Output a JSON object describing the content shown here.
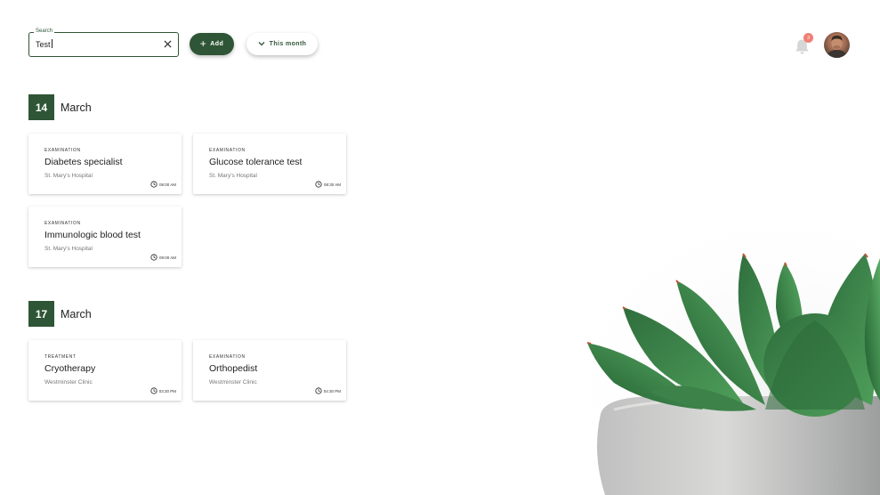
{
  "search": {
    "label": "Search",
    "value": "Test"
  },
  "toolbar": {
    "add_label": "Add",
    "filter_label": "This month"
  },
  "notifications": {
    "count": "3"
  },
  "days": [
    {
      "day": "14",
      "month": "March",
      "appointments": [
        {
          "category": "EXAMINATION",
          "title": "Diabetes specialist",
          "place": "St. Mary's Hospital",
          "time": "08:00 AM"
        },
        {
          "category": "EXAMINATION",
          "title": "Glucose tolerance test",
          "place": "St. Mary's Hospital",
          "time": "08:30 AM"
        },
        {
          "category": "EXAMINATION",
          "title": "Immunologic blood test",
          "place": "St. Mary's Hospital",
          "time": "09:00 AM"
        }
      ]
    },
    {
      "day": "17",
      "month": "March",
      "appointments": [
        {
          "category": "TREATMENT",
          "title": "Cryotherapy",
          "place": "Westminster Clinic",
          "time": "03:30 PM"
        },
        {
          "category": "EXAMINATION",
          "title": "Orthopedist",
          "place": "Westminster Clinic",
          "time": "04:30 PM"
        }
      ]
    }
  ],
  "colors": {
    "primary": "#2e5535",
    "badge": "#f07f73"
  },
  "icons": [
    "close-icon",
    "plus-icon",
    "chevron-down-icon",
    "bell-icon",
    "clock-icon"
  ]
}
